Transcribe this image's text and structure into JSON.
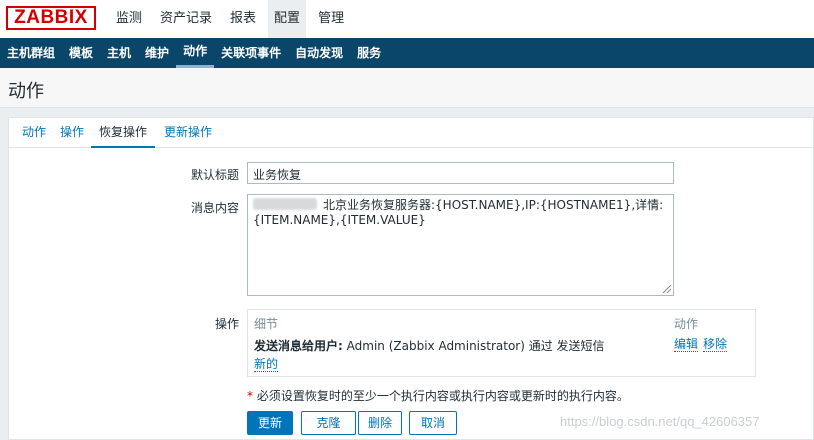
{
  "brand": {
    "logo": "ZABBIX",
    "color": "#d40000"
  },
  "top_menu": [
    "监测",
    "资产记录",
    "报表",
    "配置",
    "管理"
  ],
  "top_menu_active": "配置",
  "sub_menu": [
    "主机群组",
    "模板",
    "主机",
    "维护",
    "动作",
    "关联项事件",
    "自动发现",
    "服务"
  ],
  "sub_menu_active": "动作",
  "page_title": "动作",
  "tabs": [
    "动作",
    "操作",
    "恢复操作",
    "更新操作"
  ],
  "tab_active": "恢复操作",
  "form": {
    "default_subject_label": "默认标题",
    "default_subject_value": "业务恢复",
    "message_label": "消息内容",
    "message_line1": "北京业务恢复服务器:{HOST.NAME},IP:{HOSTNAME1},详情:",
    "message_line2": "{ITEM.NAME},{ITEM.VALUE}",
    "operations_label": "操作",
    "ops_col_details": "细节",
    "ops_col_action": "动作",
    "op_row_bold": "发送消息给用户:",
    "op_row_text": "Admin (Zabbix Administrator) 通过 发送短信",
    "op_edit": "编辑",
    "op_remove": "移除",
    "op_new": "新的",
    "required_star": "*",
    "required_note": "必须设置恢复时的至少一个执行内容或执行内容或更新时的执行内容。"
  },
  "buttons": {
    "update": "更新",
    "clone": "克隆",
    "delete": "删除",
    "cancel": "取消"
  },
  "watermark": "https://blog.csdn.net/qq_42606357",
  "colors": {
    "nav_bg": "#0a466a",
    "link": "#0275b8",
    "page_bg": "#ebeef0"
  }
}
